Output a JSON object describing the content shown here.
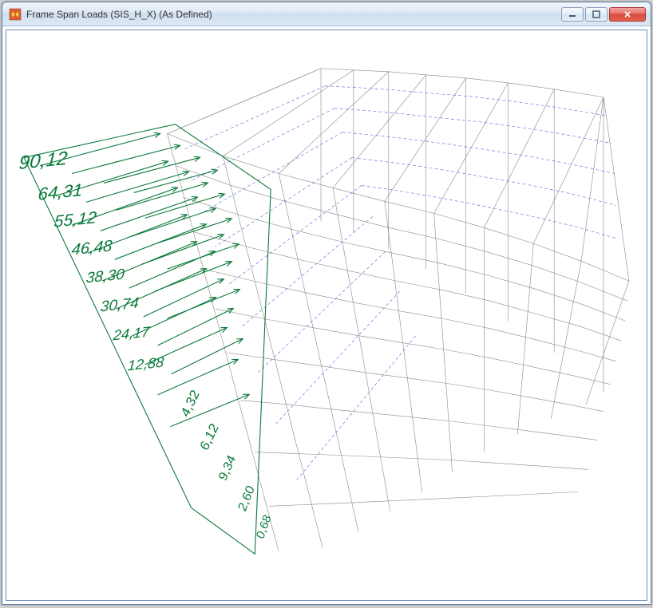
{
  "window": {
    "title": "Frame Span Loads (SIS_H_X) (As Defined)"
  },
  "loads": {
    "labels": [
      "90,12",
      "64,31",
      "55,12",
      "46,48",
      "38,30",
      "30,74",
      "24,17",
      "12,88"
    ],
    "sublabels": [
      "4,32",
      "6,12",
      "9,34",
      "2,60",
      "0,68"
    ]
  },
  "icons": {
    "minimize": "minimize-icon",
    "maximize": "maximize-icon",
    "close": "close-icon",
    "app": "app-icon"
  }
}
